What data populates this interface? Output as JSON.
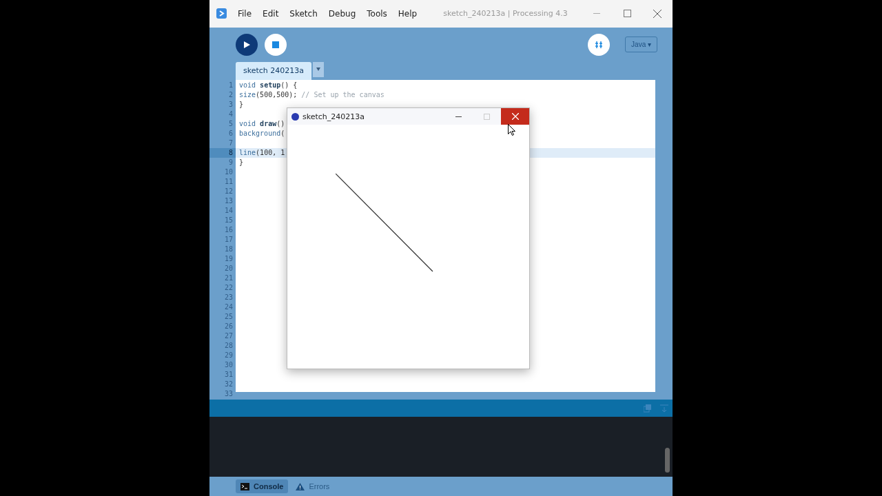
{
  "window": {
    "title": "sketch_240213a | Processing 4.3"
  },
  "menu": [
    "File",
    "Edit",
    "Sketch",
    "Debug",
    "Tools",
    "Help"
  ],
  "toolbar": {
    "mode": "Java ▾"
  },
  "tabs": [
    {
      "label": "sketch 240213a",
      "selected": true
    }
  ],
  "editor": {
    "lines": [
      {
        "number": "1",
        "selected": false,
        "tokens": [
          {
            "text": "void ",
            "kind": "keyword"
          },
          {
            "text": "setup",
            "kind": "function"
          },
          {
            "text": "() {",
            "kind": "plain"
          }
        ]
      },
      {
        "number": "2",
        "selected": false,
        "tokens": [
          {
            "text": "size",
            "kind": "keyword"
          },
          {
            "text": "(500,500); ",
            "kind": "plain"
          },
          {
            "text": "// Set up the canvas",
            "kind": "comment"
          }
        ]
      },
      {
        "number": "3",
        "selected": false,
        "tokens": [
          {
            "text": "}",
            "kind": "plain"
          }
        ]
      },
      {
        "number": "4",
        "selected": false
      },
      {
        "number": "5",
        "selected": false,
        "tokens": [
          {
            "text": "void ",
            "kind": "keyword"
          },
          {
            "text": "draw",
            "kind": "function"
          },
          {
            "text": "()",
            "kind": "plain"
          }
        ]
      },
      {
        "number": "6",
        "selected": false,
        "tokens": [
          {
            "text": "background",
            "kind": "keyword"
          },
          {
            "text": "(",
            "kind": "plain"
          }
        ]
      },
      {
        "number": "7",
        "selected": false
      },
      {
        "number": "8",
        "selected": true,
        "tokens": [
          {
            "text": "line",
            "kind": "keyword"
          },
          {
            "text": "(100, 1",
            "kind": "plain"
          }
        ]
      },
      {
        "number": "9",
        "selected": false,
        "tokens": [
          {
            "text": "}",
            "kind": "plain"
          }
        ]
      },
      {
        "number": "10",
        "selected": false
      },
      {
        "number": "11",
        "selected": false
      },
      {
        "number": "12",
        "selected": false
      },
      {
        "number": "13",
        "selected": false
      },
      {
        "number": "14",
        "selected": false
      },
      {
        "number": "15",
        "selected": false
      },
      {
        "number": "16",
        "selected": false
      },
      {
        "number": "17",
        "selected": false
      },
      {
        "number": "18",
        "selected": false
      },
      {
        "number": "19",
        "selected": false
      },
      {
        "number": "20",
        "selected": false
      },
      {
        "number": "21",
        "selected": false
      },
      {
        "number": "22",
        "selected": false
      },
      {
        "number": "23",
        "selected": false
      },
      {
        "number": "24",
        "selected": false
      },
      {
        "number": "25",
        "selected": false
      },
      {
        "number": "26",
        "selected": false
      },
      {
        "number": "27",
        "selected": false
      },
      {
        "number": "28",
        "selected": false
      },
      {
        "number": "29",
        "selected": false
      },
      {
        "number": "30",
        "selected": false
      },
      {
        "number": "31",
        "selected": false
      },
      {
        "number": "32",
        "selected": false
      },
      {
        "number": "33",
        "selected": false
      }
    ]
  },
  "sketch_window": {
    "title": "sketch_240213a"
  },
  "bottom_tabs": [
    {
      "label": "Console",
      "kind": "console",
      "selected": true
    },
    {
      "label": "Errors",
      "kind": "errors",
      "selected": false
    }
  ]
}
